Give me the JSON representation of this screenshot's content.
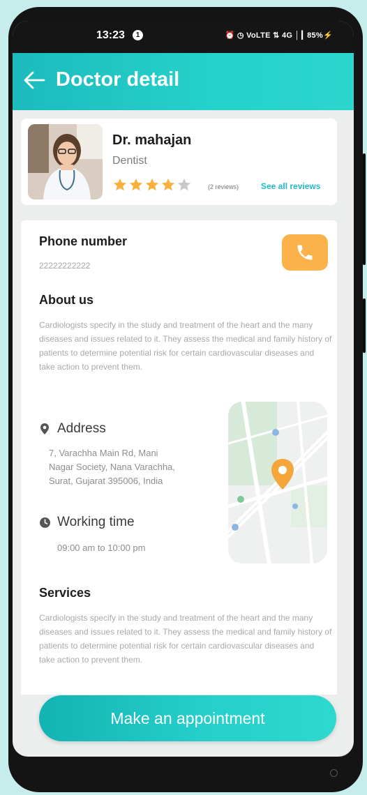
{
  "status_bar": {
    "time": "13:23",
    "notification_badge": "1",
    "icons_text": "⏰ ◷ VoLTE ⇅ 4G │┃ 85%⚡"
  },
  "app_bar": {
    "title": "Doctor detail",
    "back_icon": "arrow-left-icon"
  },
  "doctor": {
    "name": "Dr. mahajan",
    "specialty": "Dentist",
    "rating": 4,
    "rating_max": 5,
    "reviews_label": "(2 reviews)",
    "see_all_label": "See all reviews"
  },
  "phone": {
    "title": "Phone number",
    "value": "22222222222",
    "call_icon": "phone-icon",
    "button_color": "#fcb24b"
  },
  "about": {
    "title": "About us",
    "text": "Cardiologists specify in the study and treatment of the heart and the many diseases and issues related to it. They assess the medical and family history of patients to determine potential risk for certain cardiovascular diseases and take action to prevent them."
  },
  "address": {
    "title": "Address",
    "icon": "location-pin-icon",
    "text": "7, Varachha Main Rd, Mani Nagar Society, Nana Varachha, Surat, Gujarat 395006, India"
  },
  "working": {
    "title": "Working time",
    "icon": "clock-icon",
    "text": "09:00 am to 10:00 pm"
  },
  "services": {
    "title": "Services",
    "text": "Cardiologists specify in the study and treatment of the heart and the many diseases and issues related to it. They assess the medical and family history of patients to determine potential risk for certain cardiovascular diseases and take action to prevent them."
  },
  "cta": {
    "label": "Make an appointment"
  },
  "colors": {
    "accent": "#25d2cc",
    "star": "#f8b13c",
    "link": "#23b9c5"
  }
}
